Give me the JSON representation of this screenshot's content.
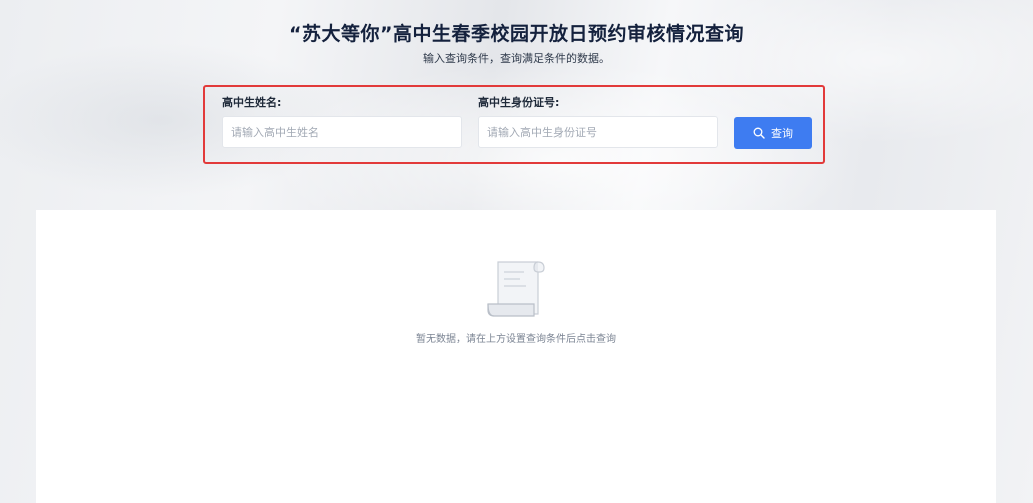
{
  "header": {
    "title": "“苏大等你”高中生春季校园开放日预约审核情况查询",
    "subtitle": "输入查询条件，查询满足条件的数据。"
  },
  "search": {
    "name_label": "高中生姓名:",
    "name_placeholder": "请输入高中生姓名",
    "name_value": "",
    "id_label": "高中生身份证号:",
    "id_placeholder": "请输入高中生身份证号",
    "id_value": "",
    "button_label": "查询",
    "button_icon": "search-icon"
  },
  "results": {
    "empty_icon": "document-scroll-icon",
    "empty_text": "暂无数据，请在上方设置查询条件后点击查询"
  },
  "colors": {
    "accent": "#3e7cf1",
    "highlight_border": "#e23a3a",
    "title_text": "#14213d"
  }
}
